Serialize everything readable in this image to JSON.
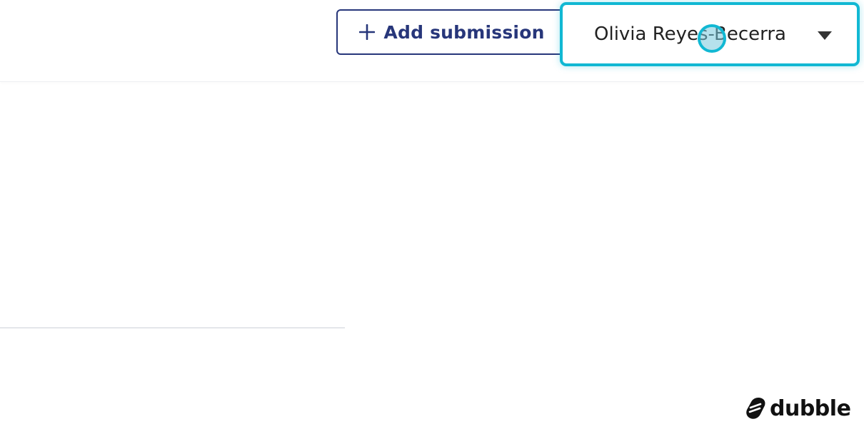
{
  "header": {
    "add_submission_label": "Add submission",
    "user_menu": {
      "name": "Olivia Reyes-Becerra"
    }
  },
  "icons": {
    "add": "plus-icon",
    "menu": "caret-down-icon",
    "brand": "dubble-logo-icon"
  },
  "branding": {
    "name": "dubble"
  },
  "colors": {
    "primary": "#27367a",
    "highlight": "#11b8d3",
    "text": "#222222"
  }
}
